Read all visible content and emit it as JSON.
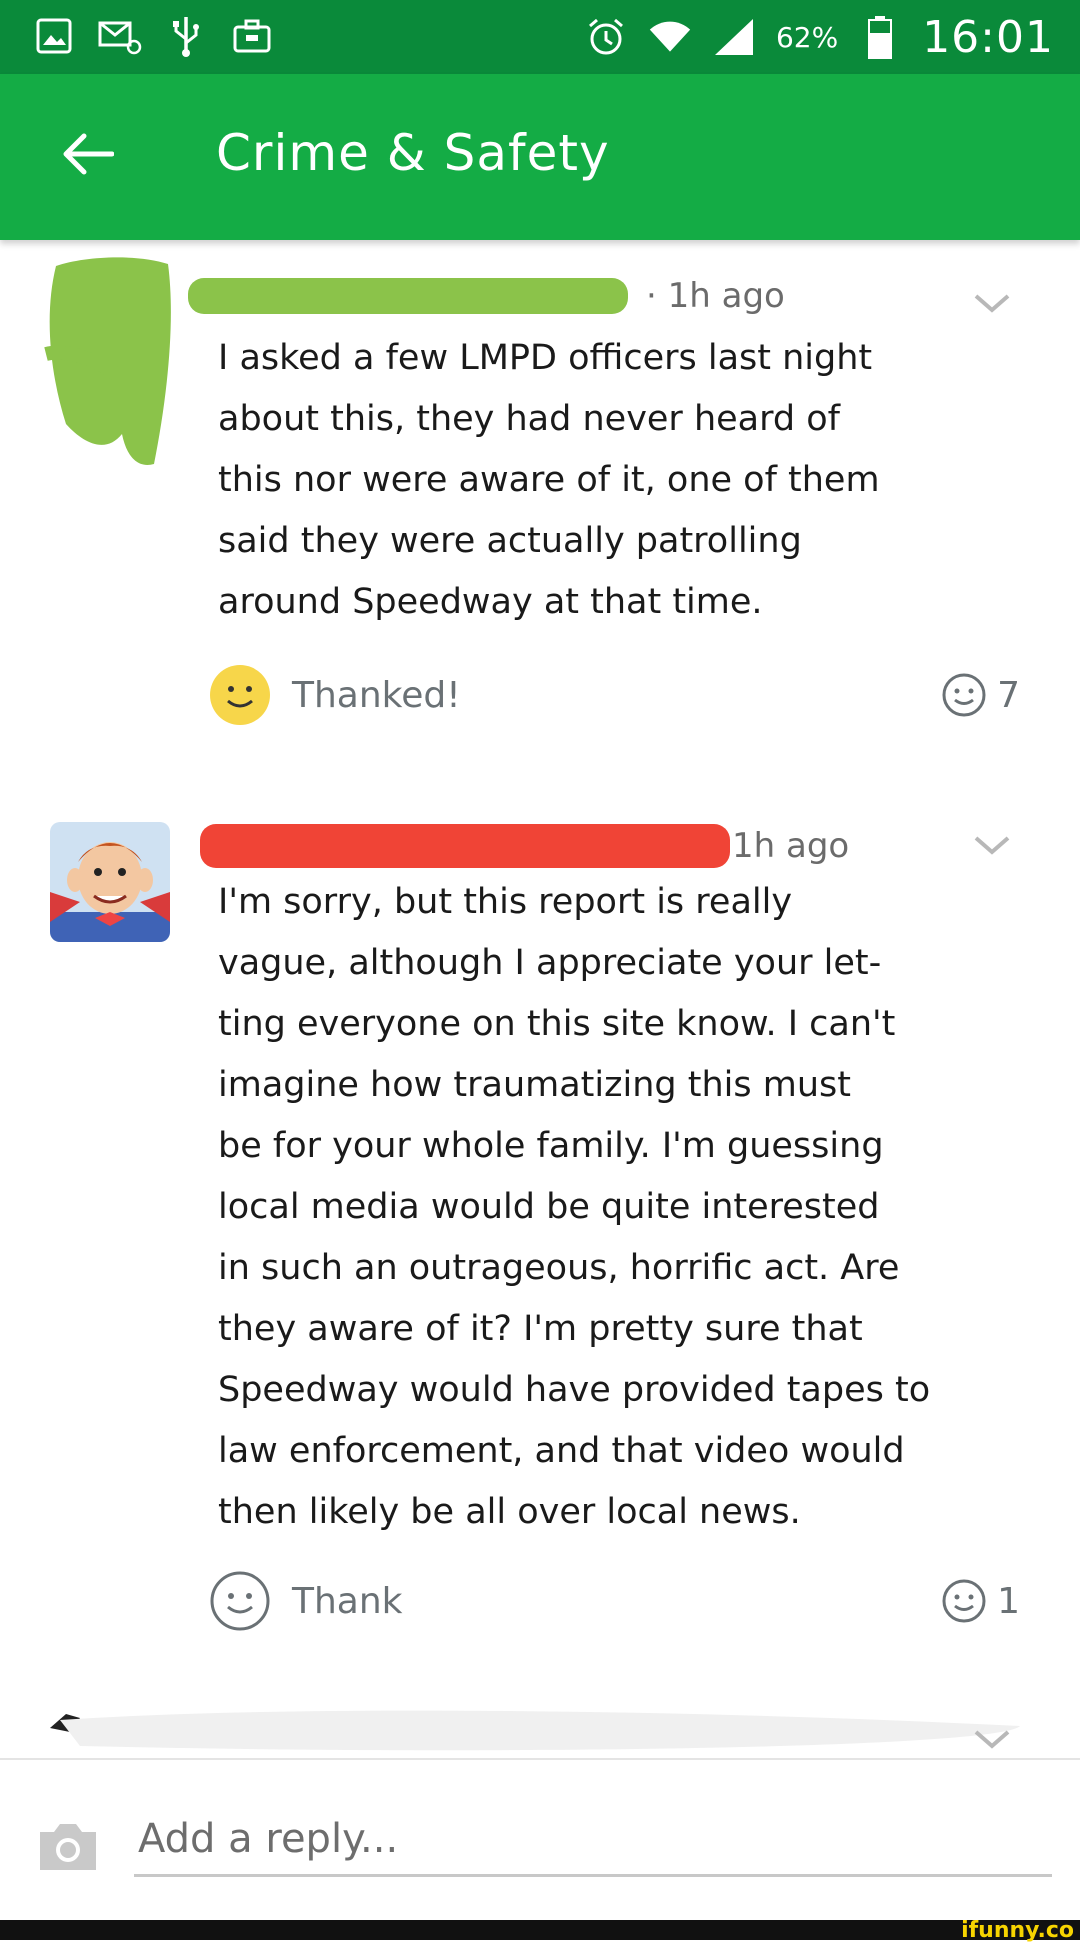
{
  "status_bar": {
    "battery": "62%",
    "time": "16:01",
    "icons": [
      "gallery-icon",
      "mail-icon",
      "usb-icon",
      "briefcase-icon",
      "alarm-icon",
      "wifi-icon",
      "signal-icon",
      "battery-icon"
    ]
  },
  "app_bar": {
    "title": "Crime & Safety",
    "back_icon": "arrow-left-icon"
  },
  "comments": [
    {
      "time": "· 1h ago",
      "text": "I asked a few LMPD officers last night\nabout this, they had never heard of\nthis nor were aware of it, one of them\nsaid they were actually patrolling\naround Speedway at that time.",
      "thank_label": "Thanked!",
      "thank_count": "7",
      "thanked": true
    },
    {
      "time": "1h ago",
      "text": "I'm sorry, but this report is really\nvague, although I appreciate your let-\nting everyone on this site know. I can't\nimagine how traumatizing this must\nbe for your whole family. I'm guessing\nlocal media would be quite interested\nin such an outrageous, horrific act. Are\nthey aware of it? I'm pretty sure that\nSpeedway would have provided tapes to\nlaw enforcement, and that video would\nthen likely be all over local news.",
      "thank_label": "Thank",
      "thank_count": "1",
      "thanked": false
    }
  ],
  "reply": {
    "placeholder": "Add a reply..."
  },
  "watermark": "ifunny.co",
  "colors": {
    "status_bar": "#0a8a3a",
    "app_bar": "#14ac45",
    "redaction_green": "#8bc34a",
    "redaction_red": "#f04436",
    "thanked_yellow": "#f7d64a"
  }
}
